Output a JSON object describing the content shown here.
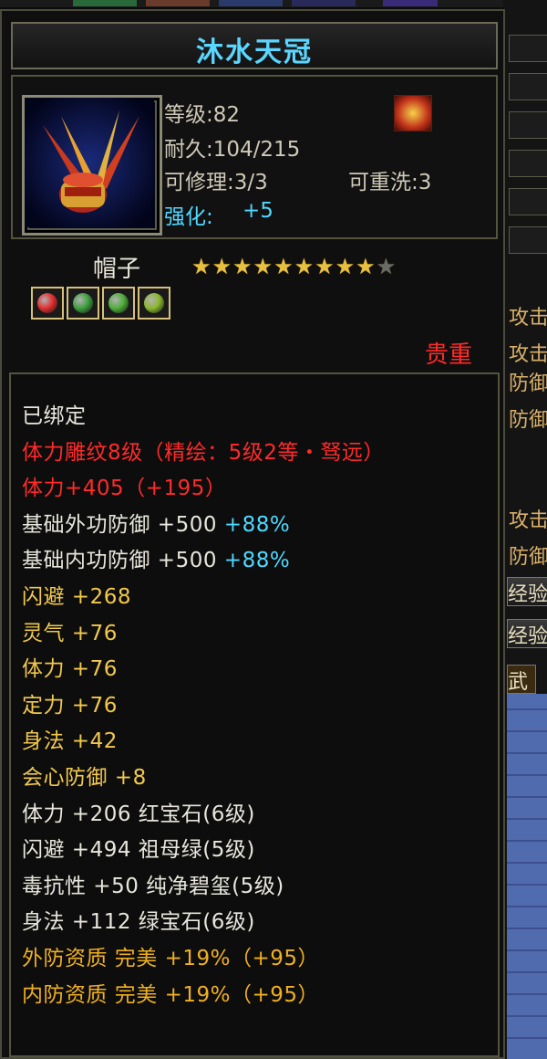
{
  "item": {
    "title": "沐水天冠",
    "level": "等级:82",
    "durability": "耐久:104/215",
    "repair": "可修理:3/3",
    "rewash": "可重洗:3",
    "enhance_label": "强化:",
    "enhance_value": "+5",
    "type": "帽子",
    "stars_filled": 9,
    "stars_total": 10,
    "rarity": "贵重",
    "icon": "winged-helmet-icon",
    "badge_icon": "flame-crest-icon"
  },
  "gems": [
    {
      "name": "red-gem-icon",
      "color": "#e23030"
    },
    {
      "name": "green-gem-icon",
      "color": "#3fa040"
    },
    {
      "name": "green-gem-icon",
      "color": "#4fae3a"
    },
    {
      "name": "jade-gem-icon",
      "color": "#8ab830"
    }
  ],
  "stats": [
    {
      "text": "已绑定",
      "color": "white"
    },
    {
      "text": "体力雕纹8级（精绘：5级2等・驽远）",
      "color": "red"
    },
    {
      "text": "体力+405（+195）",
      "color": "red"
    },
    {
      "text": "基础外功防御 +500 ",
      "extra": "+88%",
      "color": "white"
    },
    {
      "text": "基础内功防御 +500 ",
      "extra": "+88%",
      "color": "white"
    },
    {
      "text": "闪避 +268",
      "color": "yellow"
    },
    {
      "text": "灵气 +76",
      "color": "yellow"
    },
    {
      "text": "体力 +76",
      "color": "yellow"
    },
    {
      "text": "定力 +76",
      "color": "yellow"
    },
    {
      "text": "身法 +42",
      "color": "yellow"
    },
    {
      "text": "会心防御 +8",
      "color": "yellow"
    },
    {
      "text": "体力 +206 红宝石(6级)",
      "color": "white2"
    },
    {
      "text": "闪避 +494 祖母绿(5级)",
      "color": "white2"
    },
    {
      "text": "毒抗性 +50 纯净碧玺(5级)",
      "color": "white2"
    },
    {
      "text": "身法 +112 绿宝石(6级)",
      "color": "white2"
    },
    {
      "text": "外防资质  完美 +19%（+95）",
      "color": "orange"
    },
    {
      "text": "内防资质  完美 +19%（+95）",
      "color": "orange"
    }
  ],
  "right_panel": {
    "labels": [
      "攻击",
      "攻击",
      "防御",
      "防御",
      "攻击",
      "防御"
    ],
    "buttons": [
      "经验",
      "经验",
      "武"
    ]
  }
}
